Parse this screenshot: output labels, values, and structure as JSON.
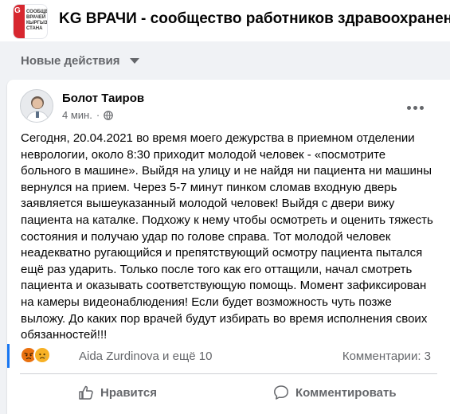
{
  "header": {
    "group_name": "KG ВРАЧИ - сообщество работников здравоохранения Кыргызстана",
    "logo": {
      "badge": "G",
      "lines": [
        "СООБЩЕСТВО",
        "ВРАЧЕЙ",
        "КЫРГЫЗ",
        "СТАНА"
      ],
      "accent_color": "#d7272f"
    }
  },
  "feed_filter": {
    "label": "Новые действия",
    "icon": "caret-down-icon"
  },
  "post": {
    "author": "Болот Таиров",
    "time": "4 мин.",
    "audience_icon": "globe-icon",
    "menu_icon": "more-horizontal-icon",
    "text": "Сегодня, 20.04.2021 во время моего дежурства в приемном отделении неврологии, около 8:30 приходит молодой человек - «посмотрите больного в машине». Выйдя на улицу и не найдя ни пациента ни машины вернулся на прием. Через 5-7 минут пинком сломав входную дверь заявляется вышеуказанный молодой человек! Выйдя с двери вижу пациента на каталке. Подхожу к нему чтобы осмотреть и оценить тяжесть состояния и получаю удар по голове справа. Тот молодой человек неадекватно ругающийся и препятствующий осмотру пациента пытался ещё раз ударить. Только после того как его оттащили, начал смотреть пациента и оказывать соответствующую помощь. Момент зафиксирован на камеры видеонаблюдения! Если будет возможность чуть позже выложу. До каких пор врачей будут избирать во время исполнения своих обязанностей!!!",
    "reactions": {
      "icons": [
        "angry-reaction-icon",
        "sad-reaction-icon"
      ],
      "colors": {
        "angry": "#e9710f",
        "sad": "#f7b125"
      },
      "label": "Aida Zurdinova и ещё 10"
    },
    "comments_count": "Комментарии: 3",
    "actions": {
      "like": "Нравится",
      "comment": "Комментировать"
    }
  },
  "colors": {
    "background": "#f0f2f5",
    "secondary_text": "#65676b",
    "accent_blue": "#1877f2"
  }
}
